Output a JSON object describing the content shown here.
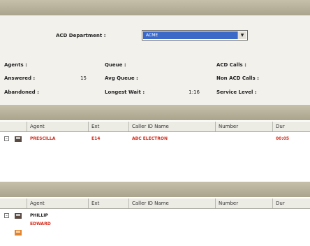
{
  "department_details": {
    "title": "",
    "acd_department_label": "ACD Department :",
    "acd_department_value": "ACME",
    "stats": {
      "agents": {
        "label": "Agents :",
        "value": ""
      },
      "answered": {
        "label": "Answered :",
        "value": "15"
      },
      "abandoned": {
        "label": "Abandoned :",
        "value": ""
      },
      "queue": {
        "label": "Queue :",
        "value": ""
      },
      "avg_queue": {
        "label": "Avg Queue :",
        "value": ""
      },
      "longest_wait": {
        "label": "Longest Wait :",
        "value": "1:16"
      },
      "acd_calls": {
        "label": "ACD Calls :",
        "value": ""
      },
      "non_acd_calls": {
        "label": "Non ACD Calls :",
        "value": ""
      },
      "service_level": {
        "label": "Service Level :",
        "value": ""
      }
    }
  },
  "logged_in_agents": {
    "title": "",
    "columns": [
      "Agent",
      "Ext",
      "Caller ID Name",
      "Number",
      "Dur"
    ],
    "rows": [
      {
        "agent": "PRESCILLA",
        "ext": "E14",
        "caller_id_name": "ABC ELECTRON",
        "number": "",
        "dur": "00:05"
      },
      {
        "agent": "",
        "ext": "",
        "caller_id_name": "",
        "number": "",
        "dur": ""
      },
      {
        "agent": "",
        "ext": "",
        "caller_id_name": "",
        "number": "",
        "dur": ""
      }
    ]
  },
  "logged_out_agents": {
    "title": "",
    "columns": [
      "Agent",
      "Ext",
      "Caller ID Name",
      "Number",
      "Dur"
    ],
    "rows": [
      {
        "agent": "PHILLIP",
        "ext": "",
        "caller_id_name": "",
        "number": "",
        "dur": ""
      },
      {
        "agent": "EDWARD",
        "ext": "",
        "caller_id_name": "",
        "number": "",
        "dur": ""
      },
      {
        "agent": "",
        "ext": "",
        "caller_id_name": "",
        "number": "",
        "dur": ""
      }
    ]
  },
  "colors": {
    "header_bar": "#b5af98",
    "status_red": "#d42a1a",
    "status_green": "#2f8a2f",
    "status_orange": "#e5832a",
    "status_black": "#1a1a1a",
    "selection_blue": "#3b69c7"
  },
  "icons": {
    "dropdown": "chevron-down-icon",
    "expander": "expander-minus-icon",
    "agent_phone": "phone-icon"
  }
}
